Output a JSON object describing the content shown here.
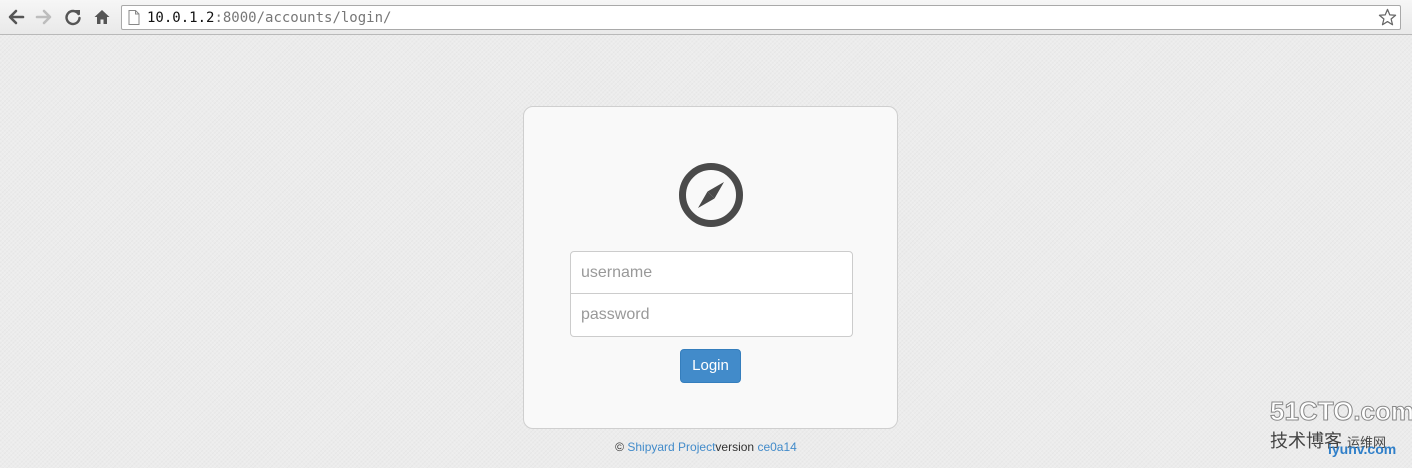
{
  "browser": {
    "url_host": "10.0.1.2",
    "url_rest": ":8000/accounts/login/",
    "icons": [
      "back-icon",
      "forward-icon",
      "reload-icon",
      "home-icon",
      "page-icon",
      "bookmark-star-icon"
    ]
  },
  "login": {
    "logo_icon": "compass-icon",
    "username_placeholder": "username",
    "password_placeholder": "password",
    "submit_label": "Login",
    "accent_color": "#428bca"
  },
  "footer": {
    "copyright": "©",
    "project_link": "Shipyard Project",
    "version_label": "version",
    "version_link": "ce0a14"
  },
  "watermark": {
    "brand": "51CTO.com",
    "line2": "技术博客",
    "line2_extra": "运维网",
    "line3": "iyunv.com"
  }
}
